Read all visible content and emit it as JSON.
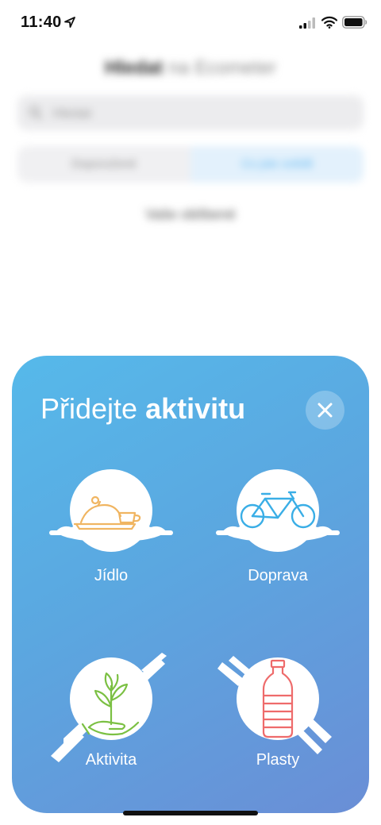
{
  "status_bar": {
    "time": "11:40",
    "icons": [
      "location-arrow-icon",
      "signal-icon",
      "wifi-icon",
      "battery-icon"
    ]
  },
  "background": {
    "title_bold": "Hledat",
    "title_light": "na Ecometer",
    "search_placeholder": "Hledat",
    "segment_left": "Doporučené",
    "segment_right": "Co jste snědli",
    "link": "Vaše oblíbené"
  },
  "modal": {
    "title_regular": "Přidejte",
    "title_bold": "aktivitu",
    "close_icon": "close-icon",
    "gradient": [
      "#56b9ea",
      "#6a8ed6"
    ],
    "tiles": [
      {
        "label": "Jídlo",
        "icon": "food-tray-cup-icon",
        "color": "#f0b561"
      },
      {
        "label": "Doprava",
        "icon": "bicycle-icon",
        "color": "#3aaee6"
      },
      {
        "label": "Aktivita",
        "icon": "plant-in-hand-icon",
        "color": "#7bc043"
      },
      {
        "label": "Plasty",
        "icon": "plastic-bottle-icon",
        "color": "#ee6b6b"
      }
    ]
  }
}
